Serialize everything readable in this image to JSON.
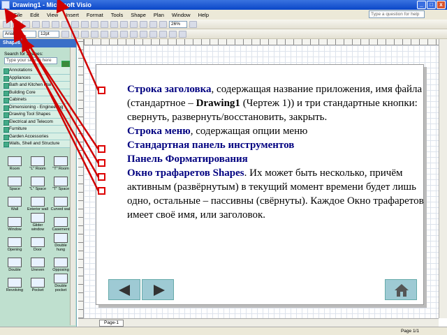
{
  "window": {
    "title": "Drawing1 - Microsoft Visio",
    "minimize": "_",
    "maximize": "□",
    "close": "x"
  },
  "menu": {
    "items": [
      "File",
      "Edit",
      "View",
      "Insert",
      "Format",
      "Tools",
      "Shape",
      "Plan",
      "Window",
      "Help"
    ],
    "ask_placeholder": "Type a question for help"
  },
  "toolbar": {
    "zoom": "26%"
  },
  "format_toolbar": {
    "font": "Arial",
    "size": "12pt"
  },
  "shapes_panel": {
    "title": "Shapes",
    "search_label": "Search for Shapes:",
    "search_placeholder": "Type your search here",
    "stencils": [
      "Annotations",
      "Appliances",
      "Bath and Kitchen Plan",
      "Building Core",
      "Cabinets",
      "Dimensioning - Engineering",
      "Drawing Tool Shapes",
      "Electrical and Telecom",
      "Furniture",
      "Garden Accessories",
      "Walls, Shell and Structure"
    ],
    "shapes": [
      "Room",
      "\"L\" Room",
      "\"T\" Room",
      "Space",
      "\"L\" Space",
      "\"T\" Space",
      "Wall",
      "Exterior wall",
      "Curved wall",
      "Window",
      "Glider window",
      "Casement",
      "Opening",
      "Door",
      "Double hung",
      "Double",
      "Uneven",
      "Opposing",
      "Revolving",
      "Pocket",
      "Double pocket"
    ]
  },
  "slide": {
    "items": [
      {
        "highlight": "Строка заголовка",
        "text": ", содержащая название приложения, имя файла (стандартное – ",
        "bold": "Drawing1",
        "rest": " (Чертеж 1)) и три стандартные кнопки: свернуть, развернуть/восстановить, закрыть."
      },
      {
        "highlight": "Строка меню",
        "text": ", содержащая опции меню"
      },
      {
        "highlight": "Стандартная панель инструментов"
      },
      {
        "highlight": "Панель Форматирования"
      },
      {
        "highlight": "Окно трафаретов Shapes",
        "text": ". Их может быть несколько, причём активным (развёрнутым) в текущий момент времени будет лишь одно, остальные – пассивны (свёрнуты). Каждое Окно трафаретов имеет своё имя, или заголовок."
      }
    ]
  },
  "page_tab": "Page-1",
  "status": {
    "page": "Page 1/1"
  },
  "colors": {
    "highlight_text": "#000080",
    "arrow": "#d00000",
    "title_bar": "#0a46c8"
  }
}
